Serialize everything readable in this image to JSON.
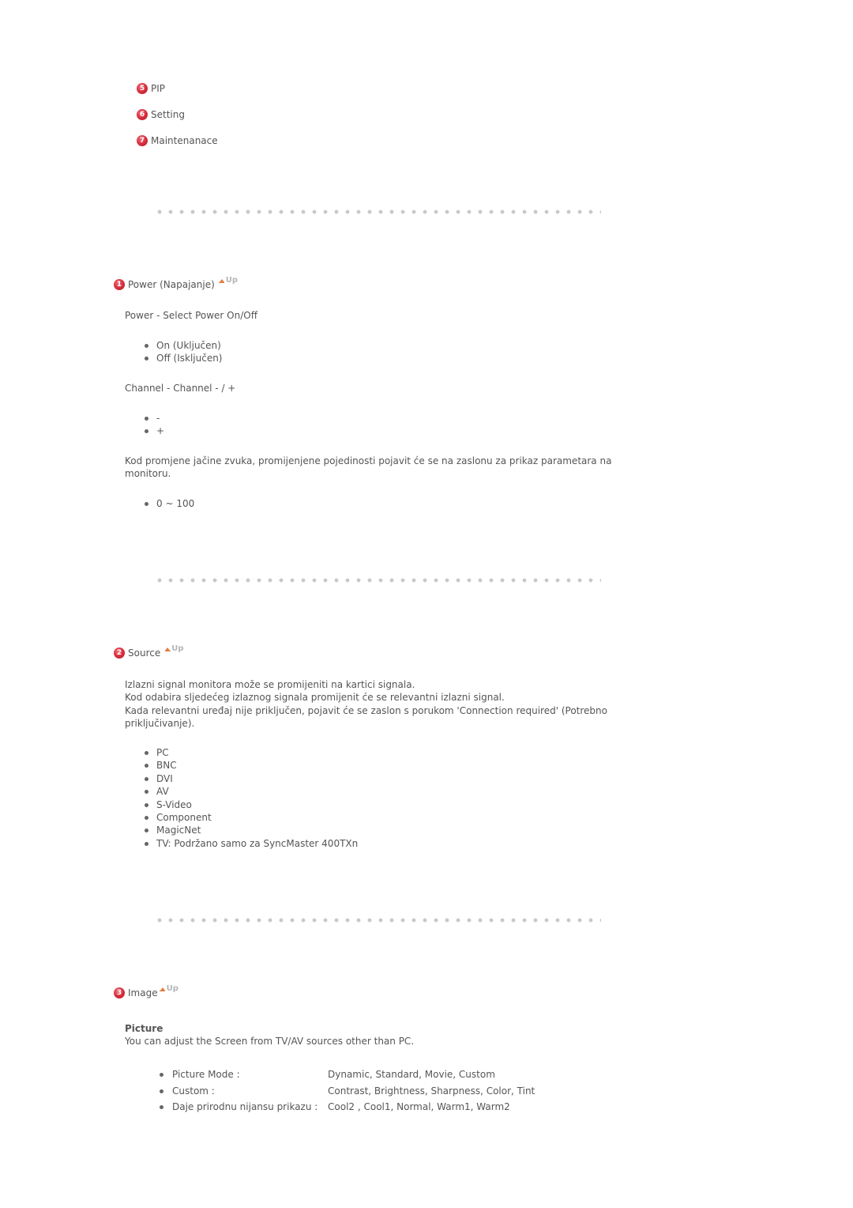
{
  "nav": {
    "items": [
      {
        "number": "5",
        "label": "PIP"
      },
      {
        "number": "6",
        "label": "Setting"
      },
      {
        "number": "7",
        "label": "Maintenanace"
      }
    ]
  },
  "up_label": "Up",
  "sections": {
    "power": {
      "number": "1",
      "title": "Power (Napajanje)",
      "power_line": "Power - Select Power On/Off",
      "power_options": [
        "On (Uključen)",
        "Off (Isključen)"
      ],
      "channel_line": "Channel - Channel - / +",
      "channel_options": [
        "-",
        "+"
      ],
      "volume_text": "Kod promjene jačine zvuka, promijenjene pojedinosti pojavit će se na zaslonu za prikaz parametara na monitoru.",
      "volume_range": [
        "0 ~ 100"
      ]
    },
    "source": {
      "number": "2",
      "title": "Source",
      "lines": [
        "Izlazni signal monitora može se promijeniti na kartici signala.",
        "Kod odabira sljedećeg izlaznog signala promijenit će se relevantni izlazni signal.",
        "Kada relevantni uređaj nije priključen, pojavit će se zaslon s porukom 'Connection required' (Potrebno priključivanje)."
      ],
      "options": [
        "PC",
        "BNC",
        "DVI",
        "AV",
        "S-Video",
        "Component",
        "MagicNet",
        "TV: Podržano samo za SyncMaster 400TXn"
      ]
    },
    "image": {
      "number": "3",
      "title": "Image",
      "subheading": "Picture",
      "description": "You can adjust the Screen from TV/AV sources other than PC.",
      "features": [
        {
          "label": "Picture Mode :",
          "value": "Dynamic, Standard, Movie, Custom"
        },
        {
          "label": "Custom :",
          "value": "Contrast, Brightness, Sharpness, Color, Tint"
        },
        {
          "label": "Daje prirodnu nijansu prikazu :",
          "value": "Cool2 , Cool1, Normal, Warm1, Warm2"
        }
      ]
    }
  },
  "colors": {
    "badge_red": "#d42b3a",
    "up_arrow_orange": "#e67a3a",
    "text_gray": "#555555",
    "separator_gray": "#c8c8c8"
  }
}
